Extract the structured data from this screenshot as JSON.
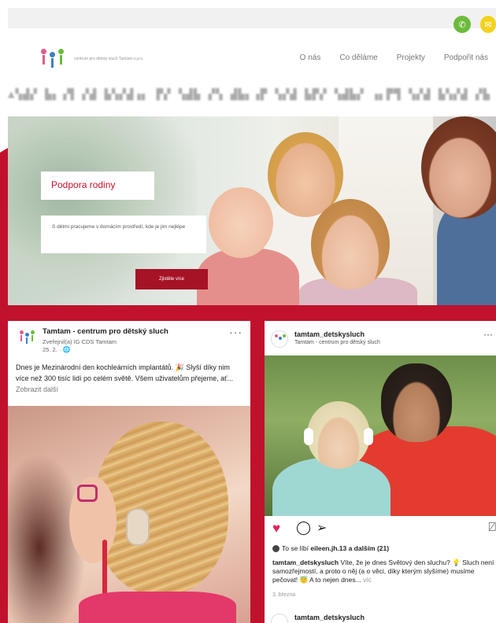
{
  "website": {
    "logo_text": "centrum pro dětský sluch Tamtam o.p.s.",
    "menu": [
      "O nás",
      "Co děláme",
      "Projekty",
      "Podpořit nás"
    ],
    "pattern_text": "",
    "hero": {
      "title": "Podpora rodiny",
      "text": "S dětmi pracujeme v domácím prostředí, kde je jim nejlépe",
      "button": "Zjistěte více"
    },
    "icons": {
      "phone": "phone-icon",
      "mail": "mail-icon"
    }
  },
  "facebook_post": {
    "page_name": "Tamtam - centrum pro dětský sluch",
    "published_by": "Zveřejnil(a) IG CDS Tamtam",
    "date": "25. 2. ·",
    "globe": "🌐",
    "more": "···",
    "text": "Dnes je Mezinárodní den kochleárních implantátů. 🎉 Slyší díky nim více než 300 tisíc lidí po celém světě. Všem uživatelům přejeme, ať...",
    "more_link": " Zobrazit další"
  },
  "instagram_post": {
    "user": "tamtam_detskysluch",
    "subtitle": "Tamtam - centrum pro dětský sluch",
    "more": "···",
    "likes_prefix": "To se líbí ",
    "likes_user": "eileen.jh.13",
    "likes_suffix": " a dalším (21)",
    "caption_user": "tamtam_detskysluch",
    "caption_text": " Víte, že je dnes Světový den sluchu? 💡 Sluch není samozřejmostí, a proto o něj (a o věci, díky kterým slyšíme) musíme pečovat! 😇 A to nejen dnes...",
    "caption_more": " víc",
    "date": "3. března",
    "next_user": "tamtam_detskysluch"
  },
  "colors": {
    "brand_red": "#c0122d",
    "like_red": "#e0245e"
  }
}
